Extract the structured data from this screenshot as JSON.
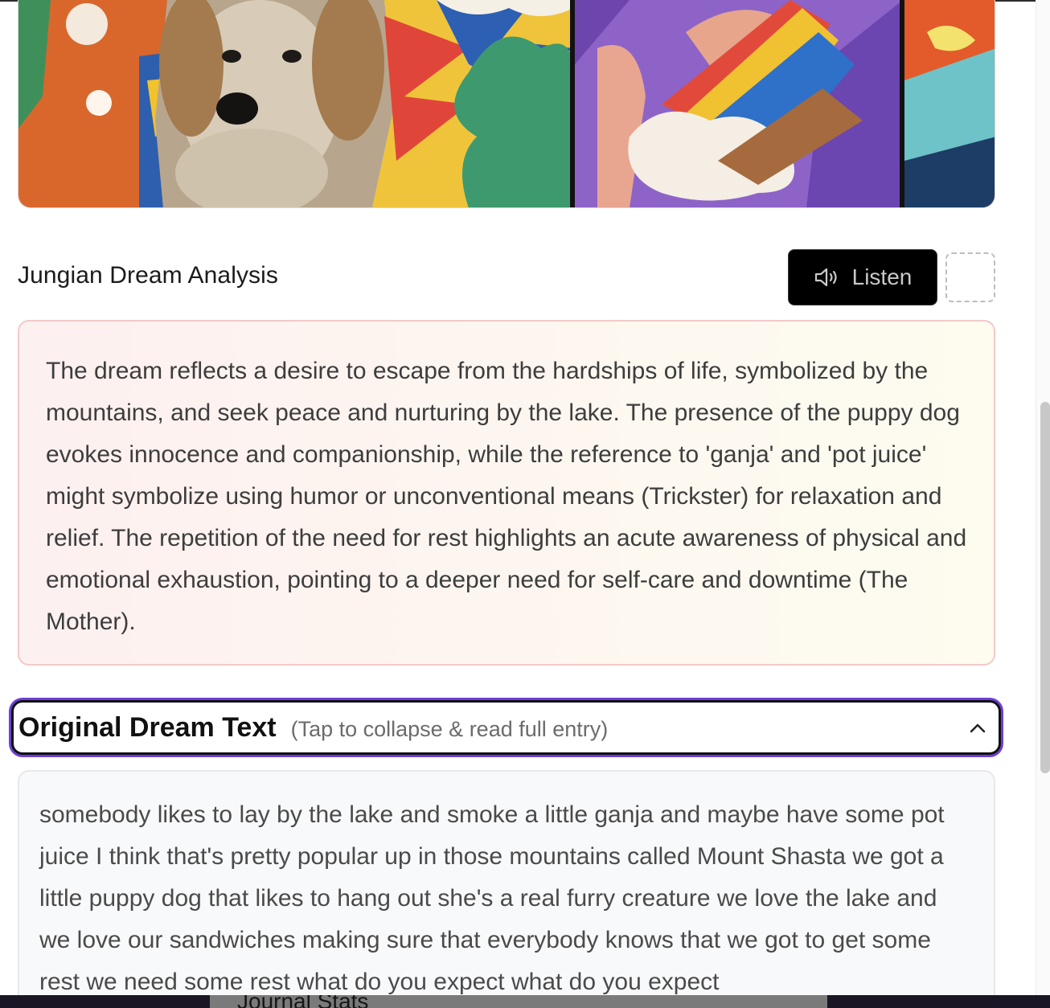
{
  "banner": {
    "image_description_icon": "comic-dream-banner-image"
  },
  "analysis": {
    "heading": "Jungian Dream Analysis",
    "listen_label": "Listen",
    "listen_icon": "speaker-icon",
    "body": "The dream reflects a desire to escape from the hardships of life, symbolized by the mountains, and seek peace and nurturing by the lake. The presence of the puppy dog evokes innocence and companionship, while the reference to 'ganja' and 'pot juice' might symbolize using humor or unconventional means (Trickster) for relaxation and relief. The repetition of the need for rest highlights an acute awareness of physical and emotional exhaustion, pointing to a deeper need for self-care and downtime (The Mother)."
  },
  "original": {
    "title": "Original Dream Text",
    "hint": "(Tap to collapse & read full entry)",
    "body": "somebody likes to lay by the lake and smoke a little ganja and maybe have some pot juice I think that's pretty popular up in those mountains called Mount Shasta we got a little puppy dog that likes to hang out she's a real furry creature we love the lake and we love our sandwiches making sure that everybody knows that we got to get some rest we need some rest what do you expect what do you expect"
  },
  "bottom_nav": {
    "tab_label": "Journal Stats"
  },
  "colors": {
    "focus_ring": "#6d3fd6",
    "analysis_border": "#f2c9c9",
    "listen_bg": "#000000"
  }
}
